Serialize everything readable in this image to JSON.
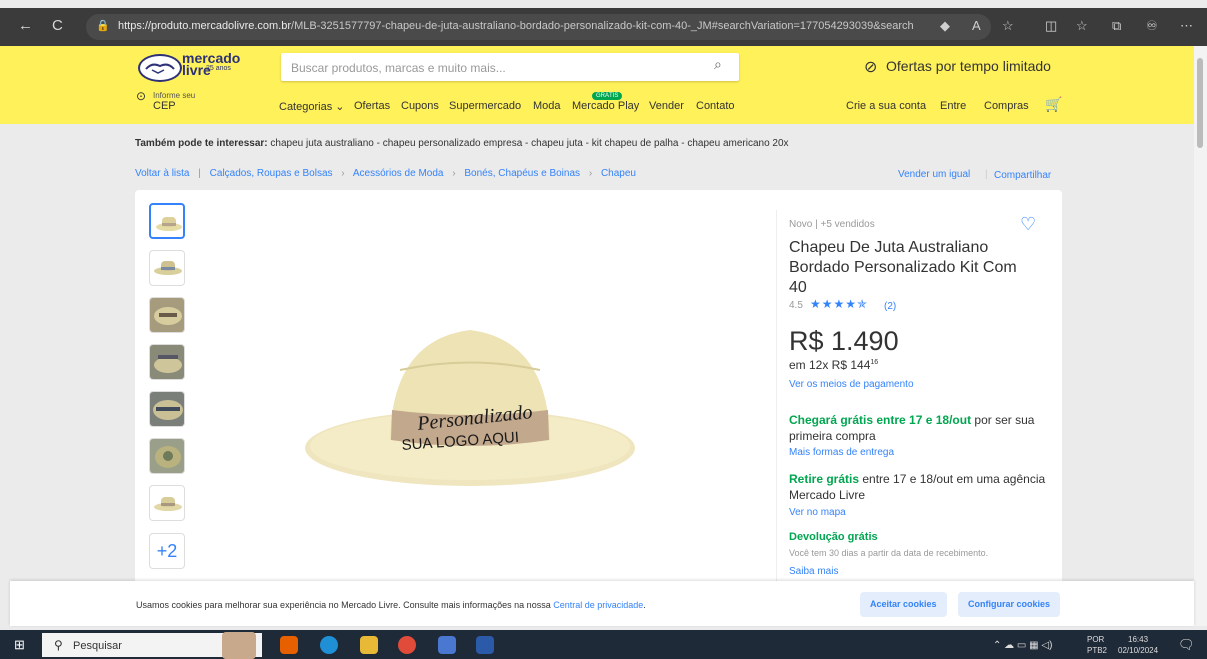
{
  "browser": {
    "url_host": "https://produto.mercadolivre.com.br",
    "url_path": "/MLB-3251577797-chapeu-de-juta-australiano-bordado-personalizado-kit-com-40-_JM#searchVariation=177054293039&search",
    "nav_back": "←",
    "nav_refresh": "C"
  },
  "header": {
    "logo_line1": "mercado",
    "logo_line2": "livre",
    "logo_sub": "25 anos",
    "search_placeholder": "Buscar produtos, marcas e muito mais...",
    "offer_label": "Ofertas por tempo limitado",
    "cep_small": "Informe seu",
    "cep_big": "CEP",
    "nav": [
      "Categorias ⌄",
      "Ofertas",
      "Cupons",
      "Supermercado",
      "Moda",
      "Mercado Play",
      "Vender",
      "Contato"
    ],
    "gratis_tag": "GRÁTIS",
    "account": [
      "Crie a sua conta",
      "Entre",
      "Compras"
    ]
  },
  "also_interest": {
    "label": "Também pode te interessar:",
    "text": "chapeu juta australiano - chapeu personalizado empresa - chapeu juta - kit chapeu de palha - chapeu americano 20x"
  },
  "breadcrumb": {
    "back": "Voltar à lista",
    "path": [
      "Calçados, Roupas e Bolsas",
      "Acessórios de Moda",
      "Bonés, Chapéus e Boinas",
      "Chapeu"
    ],
    "sell_same": "Vender um igual",
    "share": "Compartilhar"
  },
  "gallery": {
    "more_label": "+2"
  },
  "product": {
    "condition": "Novo  |  +5 vendidos",
    "title": "Chapeu De Juta Australiano Bordado Personalizado Kit Com 40",
    "rating_value": "4.5",
    "rating_stars": "★★★★✯",
    "rating_count": "(2)",
    "rating": 4.5,
    "price": "R$ 1.490",
    "installment_prefix": "em 12x R$ 144",
    "installment_cents": "16",
    "pay_link": "Ver os meios de pagamento",
    "ship_green": "Chegará grátis entre 17 e 18/out",
    "ship_rest": " por ser sua primeira compra",
    "ship_more": "Mais formas de entrega",
    "pickup_green": "Retire grátis",
    "pickup_rest": " entre 17 e 18/out em uma agência Mercado Livre",
    "map_link": "Ver no mapa",
    "return_title": "Devolução grátis",
    "return_text": "Você tem 30 dias a partir da data de recebimento.",
    "return_link": "Saiba mais",
    "hat_text1": "Personalizado",
    "hat_text2": "SUA LOGO AQUI"
  },
  "cookie": {
    "text": "Usamos cookies para melhorar sua experiência no Mercado Livre. Consulte mais informações na nossa ",
    "link": "Central de privacidade",
    "text_end": ".",
    "accept": "Aceitar cookies",
    "configure": "Configurar cookies"
  },
  "taskbar": {
    "search_placeholder": "Pesquisar",
    "lang1": "POR",
    "lang2": "PTB2",
    "time": "16:43",
    "date": "02/10/2024"
  },
  "colors": {
    "ml_yellow": "#fff159",
    "ml_blue": "#3483fa",
    "ml_green": "#00a650"
  }
}
